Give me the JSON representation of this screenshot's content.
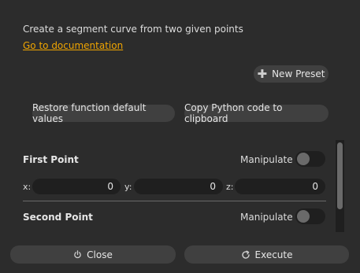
{
  "header": {
    "description": "Create a segment curve from two given points",
    "doc_link": "Go to documentation"
  },
  "toolbar": {
    "new_preset_label": "New Preset",
    "restore_label": "Restore function default values",
    "copy_label": "Copy Python code to clipboard"
  },
  "first_point": {
    "title": "First Point",
    "manipulate_label": "Manipulate",
    "x_label": "x:",
    "y_label": "y:",
    "z_label": "z:",
    "x": "0",
    "y": "0",
    "z": "0"
  },
  "second_point": {
    "title": "Second Point",
    "manipulate_label": "Manipulate"
  },
  "footer": {
    "close_label": "Close",
    "execute_label": "Execute"
  },
  "colors": {
    "background": "#2c2c2c",
    "link": "#f0a500",
    "button": "#404040",
    "field": "#1f1f1f"
  },
  "icons": {
    "new_preset": "plus-icon",
    "close": "power-icon",
    "execute": "refresh-icon"
  }
}
